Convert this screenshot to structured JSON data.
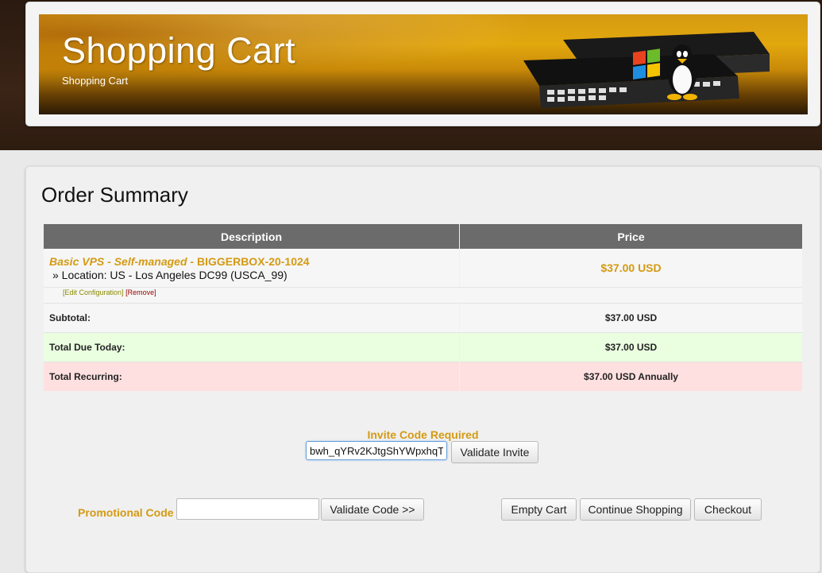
{
  "header": {
    "title": "Shopping Cart",
    "subtitle": "Shopping Cart"
  },
  "order_summary": {
    "heading": "Order Summary",
    "columns": {
      "description": "Description",
      "price": "Price"
    },
    "product": {
      "name": "Basic VPS - Self-managed",
      "separator": " - ",
      "code": "BIGGERBOX-20-1024",
      "location": "» Location: US - Los Angeles DC99 (USCA_99)",
      "price": "$37.00 USD",
      "edit_link": "[Edit Configuration]",
      "remove_link": "[Remove]"
    },
    "totals": {
      "subtotal_label": "Subtotal:",
      "subtotal_value": "$37.00 USD",
      "due_today_label": "Total Due Today:",
      "due_today_value": "$37.00 USD",
      "recurring_label": "Total Recurring:",
      "recurring_value": "$37.00 USD Annually"
    }
  },
  "invite": {
    "title": "Invite Code Required",
    "value": "bwh_qYRv2KJtgShYWpxhqT",
    "button": "Validate Invite"
  },
  "promo": {
    "label": "Promotional Code",
    "value": "",
    "button": "Validate Code >>"
  },
  "actions": {
    "empty_cart": "Empty Cart",
    "continue_shopping": "Continue Shopping",
    "checkout": "Checkout"
  },
  "colors": {
    "accent": "#d49a12",
    "table_header": "#6b6b6b",
    "due_today_bg": "#eaffe0",
    "recurring_bg": "#ffe0e0"
  }
}
